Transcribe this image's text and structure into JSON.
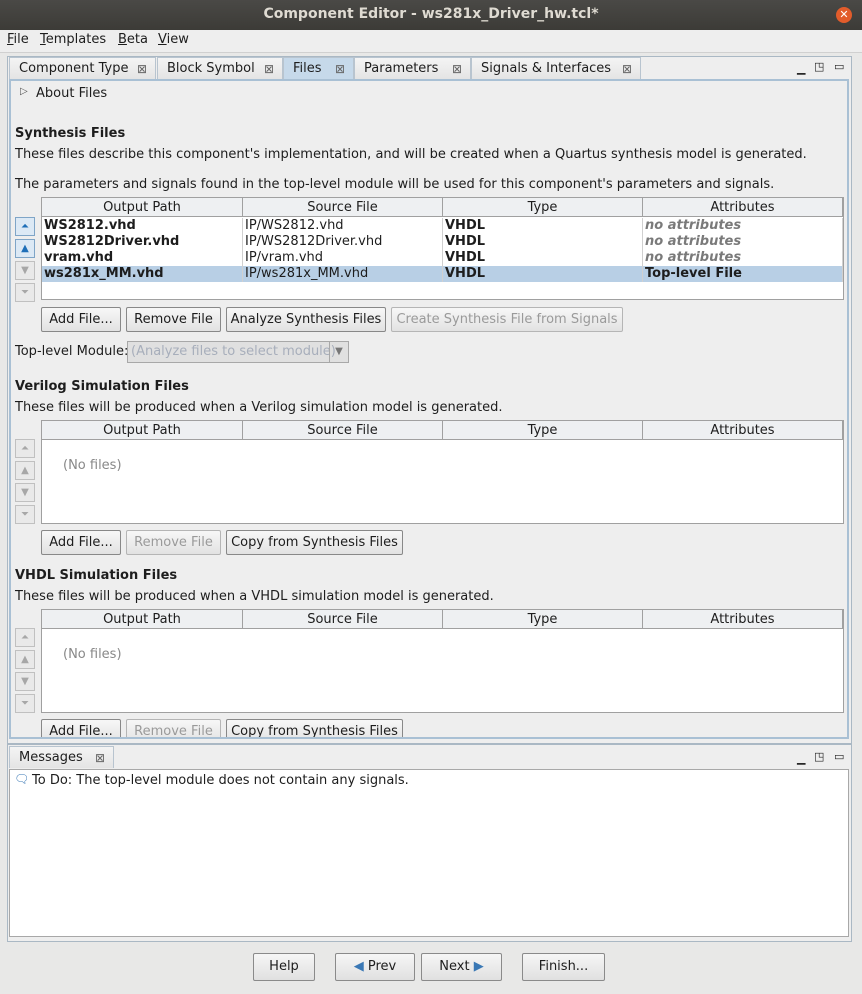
{
  "window": {
    "title": "Component Editor - ws281x_Driver_hw.tcl*"
  },
  "menu": [
    "File",
    "Templates",
    "Beta",
    "View"
  ],
  "tabs": [
    "Component Type",
    "Block Symbol",
    "Files",
    "Parameters",
    "Signals & Interfaces"
  ],
  "active_tab": "Files",
  "about": "About Files",
  "synthesis": {
    "title": "Synthesis Files",
    "desc1": "These files describe this component's implementation, and will be created when a Quartus synthesis model is generated.",
    "desc2": "The parameters and signals found in the top-level module will be used for this component's parameters and signals.",
    "columns": [
      "Output Path",
      "Source File",
      "Type",
      "Attributes"
    ],
    "rows": [
      {
        "output": "WS2812.vhd",
        "source": "IP/WS2812.vhd",
        "type": "VHDL",
        "attr": "no attributes"
      },
      {
        "output": "WS2812Driver.vhd",
        "source": "IP/WS2812Driver.vhd",
        "type": "VHDL",
        "attr": "no attributes"
      },
      {
        "output": "vram.vhd",
        "source": "IP/vram.vhd",
        "type": "VHDL",
        "attr": "no attributes"
      },
      {
        "output": "ws281x_MM.vhd",
        "source": "IP/ws281x_MM.vhd",
        "type": "VHDL",
        "attr": "Top-level File"
      }
    ],
    "buttons": {
      "add": "Add File...",
      "remove": "Remove File",
      "analyze": "Analyze Synthesis Files",
      "create": "Create Synthesis File from Signals"
    },
    "top_level_label": "Top-level Module:",
    "top_level_placeholder": "(Analyze files to select module)"
  },
  "verilog": {
    "title": "Verilog Simulation Files",
    "desc": "These files will be produced when a Verilog simulation model is generated.",
    "empty": "(No files)",
    "buttons": {
      "add": "Add File...",
      "remove": "Remove File",
      "copy": "Copy from Synthesis Files"
    }
  },
  "vhdl": {
    "title": "VHDL Simulation Files",
    "desc": "These files will be produced when a VHDL simulation model is generated.",
    "empty": "(No files)",
    "buttons": {
      "add": "Add File...",
      "remove": "Remove File",
      "copy": "Copy from Synthesis Files"
    }
  },
  "messages": {
    "tab": "Messages",
    "items": [
      "To Do: The top-level module does not contain any signals."
    ]
  },
  "footer": {
    "help": "Help",
    "prev": "Prev",
    "next": "Next",
    "finish": "Finish..."
  }
}
